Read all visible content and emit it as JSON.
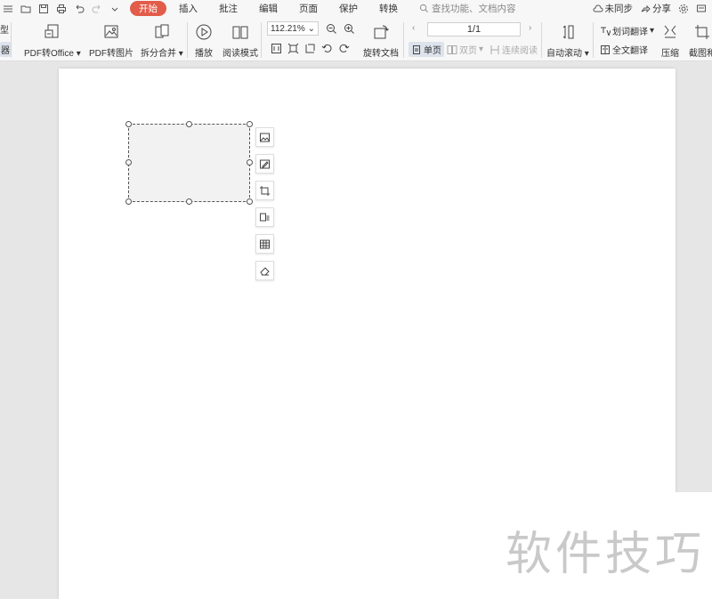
{
  "menubar": {
    "menus": [
      {
        "label": "开始",
        "active": true
      },
      {
        "label": "插入",
        "active": false
      },
      {
        "label": "批注",
        "active": false
      },
      {
        "label": "编辑",
        "active": false
      },
      {
        "label": "页面",
        "active": false
      },
      {
        "label": "保护",
        "active": false
      },
      {
        "label": "转换",
        "active": false
      }
    ],
    "search_placeholder": "查找功能、文档内容",
    "sync_label": "未同步",
    "share_label": "分享"
  },
  "ribbon": {
    "left_edge_top": "型",
    "left_edge_bottom": "器",
    "pdf_to_office": "PDF转Office",
    "pdf_to_image": "PDF转图片",
    "split_merge": "拆分合并",
    "play": "播放",
    "read_mode": "阅读模式",
    "zoom_value": "112.21%",
    "rotate_doc": "旋转文档",
    "page_indicator": "1/1",
    "single_page": "单页",
    "double_page": "双页",
    "continuous_read": "连续阅读",
    "auto_scroll": "自动滚动",
    "word_translate": "划词翻译",
    "full_translate": "全文翻译",
    "compress": "压缩",
    "screenshot": "截图和"
  },
  "watermark": "软件技巧",
  "colors": {
    "accent": "#e25c4a",
    "ribbon_bg": "#f7f7f7",
    "canvas_bg": "#e6e6e6",
    "shape_fill": "#f2f2f2"
  }
}
